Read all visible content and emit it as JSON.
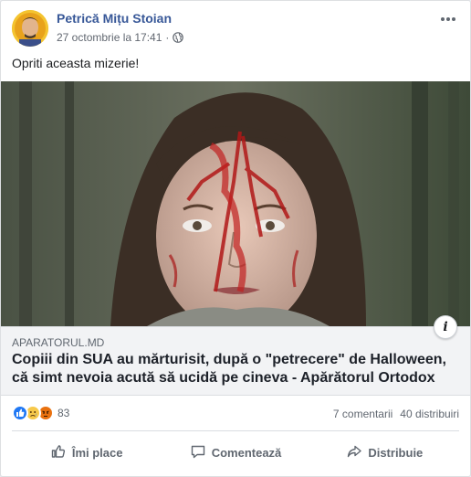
{
  "post": {
    "author": "Petrică Mițu Stoian",
    "timestamp": "27 octombrie la 17:41",
    "privacy_icon": "globe-icon",
    "text": "Opriti aceasta mizerie!"
  },
  "link": {
    "domain": "APARATORUL.MD",
    "title": "Copiii din SUA au mărturisit, după o \"petrecere\" de Halloween, că simt nevoia acută să ucidă pe cineva - Apărătorul Ortodox",
    "info_label": "i"
  },
  "stats": {
    "reactions": [
      "like",
      "sad",
      "angry"
    ],
    "reaction_count": "83",
    "comments": "7 comentarii",
    "shares": "40 distribuiri"
  },
  "actions": {
    "like": "Îmi place",
    "comment": "Comentează",
    "share": "Distribuie"
  },
  "colors": {
    "author_link": "#385898",
    "like_blue": "#2078f4",
    "sad_yellow": "#f7c94b",
    "angry_orange": "#e9710f"
  }
}
